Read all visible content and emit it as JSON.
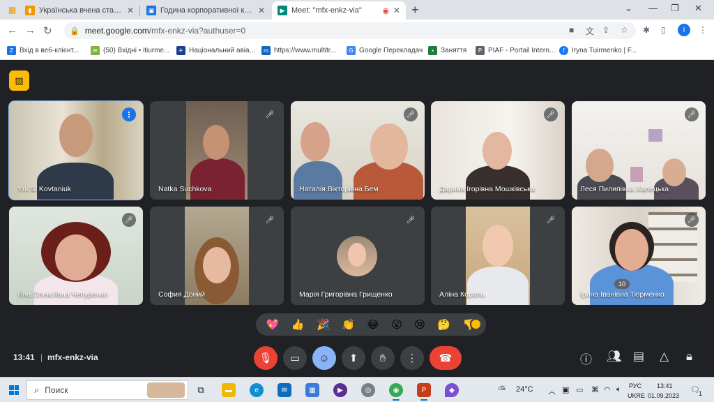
{
  "browser": {
    "tabs": [
      {
        "title": "Українська вчена стала другою",
        "favicon": "bar-chart-icon",
        "color": "#f29900"
      },
      {
        "title": "Година корпоративної культури",
        "favicon": "calendar-icon",
        "color": "#1a73e8"
      },
      {
        "title": "Meet: \"mfx-enkz-via\"",
        "favicon": "meet-icon",
        "color": "#00897b"
      }
    ],
    "url_host": "meet.google.com",
    "url_path": "/mfx-enkz-via?authuser=0",
    "profile_initial": "I",
    "bookmarks": [
      {
        "label": "Вхід в веб-клієнт...",
        "icon": "zimbra-icon",
        "color": "#1a73e8"
      },
      {
        "label": "(50) Вхідні • itiurme...",
        "icon": "mail-icon",
        "color": "#7cb342"
      },
      {
        "label": "Національний авіа...",
        "icon": "plane-icon",
        "color": "#1a3d8f"
      },
      {
        "label": "https://www.multitr...",
        "icon": "multitran-icon",
        "color": "#1565c0"
      },
      {
        "label": "Google Перекладач",
        "icon": "translate-icon",
        "color": "#4285f4"
      },
      {
        "label": "Заняття",
        "icon": "classroom-icon",
        "color": "#188038"
      },
      {
        "label": "PIAF - Portail Intern...",
        "icon": "piaf-icon",
        "color": "#5f6368"
      },
      {
        "label": "Iryna Tuirmenko | F...",
        "icon": "facebook-icon",
        "color": "#1877f2"
      }
    ]
  },
  "meet": {
    "participants": [
      {
        "name": "Yrii S. Kovtaniuk",
        "state": "speaking"
      },
      {
        "name": "Natka Suchkova",
        "state": "muted"
      },
      {
        "name": "Наталія Вікторівна Бем",
        "state": "muted"
      },
      {
        "name": "Дарина Ігорівна Мошківська",
        "state": "muted"
      },
      {
        "name": "Леся Пилипівна Халецька",
        "state": "muted"
      },
      {
        "name": "Яна Олексіївна Чепуренко",
        "state": "muted"
      },
      {
        "name": "София Доний",
        "state": "muted"
      },
      {
        "name": "Марія Григорівна Грищенко",
        "state": "muted"
      },
      {
        "name": "Аліна Король",
        "state": "muted"
      },
      {
        "name": "Ірина Іванівна Тюрменко",
        "state": "muted"
      }
    ],
    "reactions": [
      "💖",
      "👍",
      "🎉",
      "👏",
      "😂",
      "😮",
      "😢",
      "🤔",
      "👎"
    ],
    "time": "13:41",
    "meeting_code": "mfx-enkz-via",
    "people_count": "10"
  },
  "taskbar": {
    "search_placeholder": "Поиск",
    "weather": "24°C",
    "language": "РУС",
    "layout": "UKRE",
    "clock_time": "13:41",
    "clock_date": "01.09.2023",
    "notification_count": "1"
  }
}
